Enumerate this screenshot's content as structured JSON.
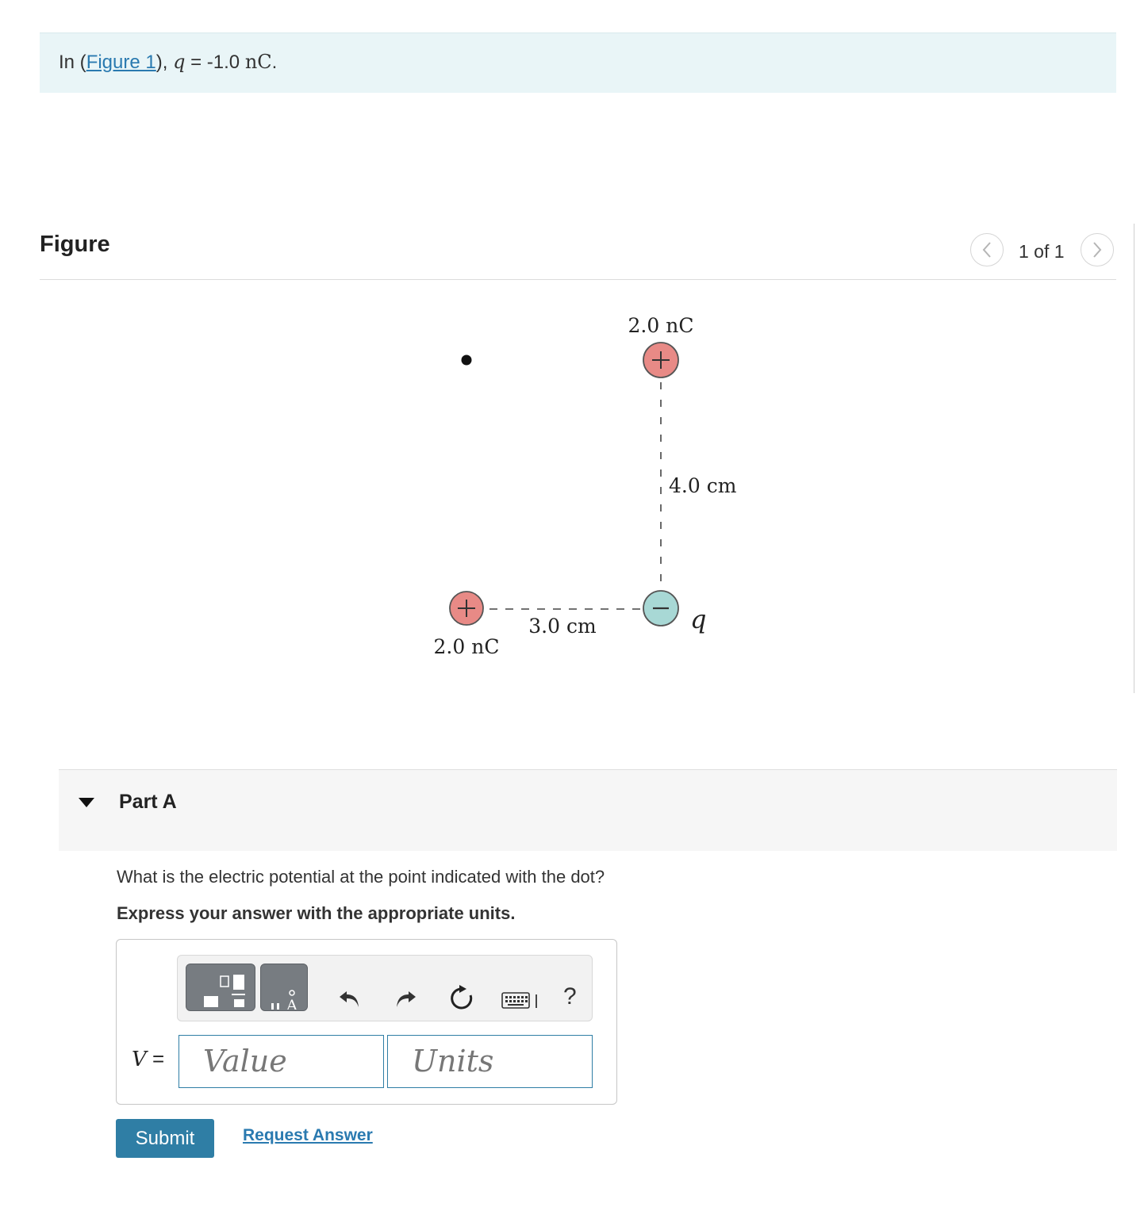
{
  "intro": {
    "prefix": "In (",
    "link": "Figure 1",
    "suffix": "), ",
    "var": "q",
    "eq": " = -1.0 ",
    "unit": "nC",
    "end": "."
  },
  "figure": {
    "title": "Figure",
    "pager": "1 of 1",
    "prev_icon": "chevron-left-icon",
    "next_icon": "chevron-right-icon",
    "diagram": {
      "top_charge_label": "2.0 nC",
      "top_charge_sign": "+",
      "left_charge_label": "2.0 nC",
      "left_charge_sign": "+",
      "q_charge_sign": "−",
      "q_label": "q",
      "vertical_distance": "4.0 cm",
      "horizontal_distance": "3.0 cm",
      "positive_color": "#e57d7d",
      "negative_color": "#9fd3d1"
    }
  },
  "part": {
    "title": "Part A",
    "question": "What is the electric potential at the point indicated with the dot?",
    "instruction": "Express your answer with the appropriate units.",
    "answer": {
      "var_label": "V",
      "equals": " =",
      "value_placeholder": "Value",
      "units_placeholder": "Units",
      "toolbar": [
        "templates-icon",
        "units-icon",
        "undo-icon",
        "redo-icon",
        "reset-icon",
        "keyboard-icon",
        "help-icon"
      ],
      "help": "?"
    },
    "submit": "Submit",
    "request": "Request Answer"
  },
  "colors": {
    "accent": "#2f7ea5",
    "intro_bg": "#e9f5f7",
    "part_bg": "#f6f6f6"
  }
}
